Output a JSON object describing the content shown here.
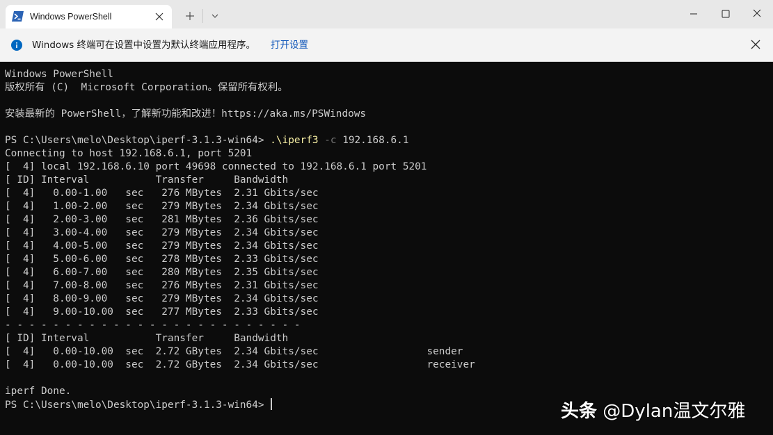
{
  "tab": {
    "title": "Windows PowerShell"
  },
  "infobar": {
    "message": "Windows 终端可在设置中设置为默认终端应用程序。",
    "link": "打开设置"
  },
  "terminal": {
    "header": [
      "Windows PowerShell",
      "版权所有 (C)  Microsoft Corporation。保留所有权利。",
      "",
      "安装最新的 PowerShell，了解新功能和改进！https://aka.ms/PSWindows",
      ""
    ],
    "prompt": "PS C:\\Users\\melo\\Desktop\\iperf-3.1.3-win64> ",
    "command": {
      "exe": ".\\iperf3",
      "flag": "-c",
      "arg": " 192.168.6.1"
    },
    "output": [
      "Connecting to host 192.168.6.1, port 5201",
      "[  4] local 192.168.6.10 port 49698 connected to 192.168.6.1 port 5201",
      "[ ID] Interval           Transfer     Bandwidth",
      "[  4]   0.00-1.00   sec   276 MBytes  2.31 Gbits/sec",
      "[  4]   1.00-2.00   sec   279 MBytes  2.34 Gbits/sec",
      "[  4]   2.00-3.00   sec   281 MBytes  2.36 Gbits/sec",
      "[  4]   3.00-4.00   sec   279 MBytes  2.34 Gbits/sec",
      "[  4]   4.00-5.00   sec   279 MBytes  2.34 Gbits/sec",
      "[  4]   5.00-6.00   sec   278 MBytes  2.33 Gbits/sec",
      "[  4]   6.00-7.00   sec   280 MBytes  2.35 Gbits/sec",
      "[  4]   7.00-8.00   sec   276 MBytes  2.31 Gbits/sec",
      "[  4]   8.00-9.00   sec   279 MBytes  2.34 Gbits/sec",
      "[  4]   9.00-10.00  sec   277 MBytes  2.33 Gbits/sec",
      "- - - - - - - - - - - - - - - - - - - - - - - - -",
      "[ ID] Interval           Transfer     Bandwidth",
      "[  4]   0.00-10.00  sec  2.72 GBytes  2.34 Gbits/sec                  sender",
      "[  4]   0.00-10.00  sec  2.72 GBytes  2.34 Gbits/sec                  receiver",
      "",
      "iperf Done."
    ],
    "final_prompt": "PS C:\\Users\\melo\\Desktop\\iperf-3.1.3-win64> "
  },
  "watermark": {
    "brand": "头条",
    "handle": " @Dylan温文尔雅"
  },
  "colors": {
    "terminal_bg": "#0c0c0c",
    "terminal_fg": "#cccccc",
    "command_yellow": "#f9f1a5",
    "flag_gray": "#767676",
    "info_blue": "#0067c0",
    "link_blue": "#0a52b8"
  },
  "icons": {
    "tab": "powershell-icon",
    "tab_close": "close-icon",
    "new_tab": "plus-icon",
    "dropdown": "chevron-down-icon",
    "minimize": "minimize-icon",
    "maximize": "maximize-icon",
    "close": "close-icon",
    "info": "info-icon",
    "info_close": "close-icon"
  }
}
